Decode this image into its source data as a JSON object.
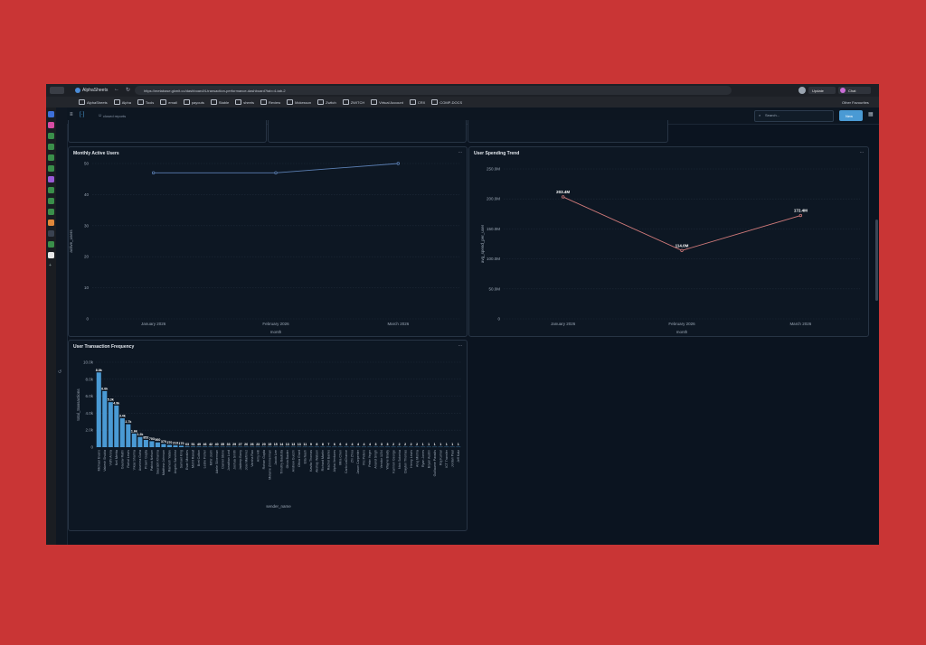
{
  "browser": {
    "tab_title": "AlphaSheets",
    "url": "https://metabase.gkmit.co/dashboard/4-transaction-performance-dashboard?tab=4-tab-2",
    "update_label": "Update",
    "chat_label": "Chat",
    "bookmarks": [
      "AlphaSheets",
      "Alpha",
      "Tools",
      "email",
      "payouts",
      "Stable",
      "sheets",
      "Review",
      "Mckesson",
      "Zwitch",
      "ZWITCH",
      "Virtual Account",
      "CRX",
      "COMP-DOCS"
    ],
    "other_favourites": "Other Favourites"
  },
  "app": {
    "breadcrumb": "closed reports",
    "search_placeholder": "Search...",
    "new_button": "New",
    "accent": "#4a9ad4"
  },
  "cards": {
    "mau": {
      "title": "Monthly Active Users",
      "menu": "...",
      "chart_data": {
        "type": "line",
        "title": "Monthly Active Users",
        "categories": [
          "January 2026",
          "February 2026",
          "March 2026"
        ],
        "values": [
          47,
          47,
          50
        ],
        "xlabel": "month",
        "ylabel": "active_users",
        "yticks": [
          "50",
          "40",
          "30",
          "20",
          "10",
          "0"
        ],
        "ylim": [
          0,
          50
        ],
        "color": "#5b7fb3",
        "grid": true
      }
    },
    "spend": {
      "title": "User Spending Trend",
      "menu": "...",
      "chart_data": {
        "type": "line",
        "title": "User Spending Trend",
        "categories": [
          "January 2026",
          "February 2026",
          "March 2026"
        ],
        "values": [
          203.4,
          114.0,
          172.4
        ],
        "point_labels": [
          "203.4M",
          "114.0M",
          "172.4M"
        ],
        "xlabel": "month",
        "ylabel": "avg_spend_per_user",
        "yticks": [
          "250.0M",
          "200.0M",
          "150.0M",
          "100.0M",
          "50.0M",
          "0"
        ],
        "ylim": [
          0,
          250
        ],
        "color": "#d17a7a",
        "grid": true
      }
    },
    "freq": {
      "title": "User Transaction Frequency",
      "menu": "...",
      "chart_data": {
        "type": "bar",
        "title": "User Transaction Frequency",
        "categories": [
          "Michael Evans",
          "Vakesh Shukla",
          "Vidhi Arora",
          "Neil Mehta",
          "Gaurav Rathi",
          "Rahul Lewis",
          "Vikas Sharma",
          "Arunima Guha",
          "Pravin Gupta",
          "Patrick Nelson",
          "Saurabh Khanna",
          "Matthew Johnson",
          "Ramesh Yadav",
          "Angelo Sanchez",
          "Samuel King",
          "Evan Morales",
          "Mohit Rawat",
          "Bret Colton",
          "Leslie Fisher",
          "Mihir Joshi",
          "Adele Silverman",
          "Daniel Stone",
          "Jonathan Lord",
          "Joshua Smith",
          "Jaideep Barry",
          "Jose Martinez",
          "Varsha Rao",
          "Amy Hill",
          "Rohan Gupta",
          "Melanie Zimmerman",
          "Jacob Lee",
          "Timothy Bautista",
          "Olivia Baxter",
          "Andrew Gucchi",
          "Olivia Grant",
          "Ella Nash",
          "Kavita Thomas",
          "Akshay Watson",
          "Richard Martin",
          "Rachel Banks",
          "Alpha Ventures",
          "Mira Chen",
          "Carlo LaChance",
          "Zhi Zhou",
          "Jason Carpenter",
          "Ric Peters",
          "Peter Yeger",
          "Anand Singh",
          "Vendor 1234",
          "Wayne Brady",
          "Kamron George",
          "Nick Solonka",
          "Clayton Thomas",
          "Henry Lewis",
          "Anuj Mishra",
          "Ryan Jones",
          "Bryan Austin",
          "Guillaume Paradis",
          "Raj Kumar",
          "ICT Transfer",
          "Jordan Paul",
          "Jeff Katz"
        ],
        "values": [
          8800,
          6600,
          5300,
          4900,
          3400,
          2700,
          1600,
          1200,
          850,
          700,
          560,
          370,
          270,
          210,
          170,
          63,
          51,
          49,
          46,
          42,
          40,
          35,
          33,
          29,
          27,
          26,
          26,
          23,
          20,
          15,
          15,
          14,
          13,
          13,
          13,
          11,
          9,
          8,
          8,
          7,
          6,
          6,
          4,
          4,
          4,
          4,
          4,
          3,
          3,
          3,
          2,
          2,
          2,
          2,
          2,
          1,
          1,
          1,
          1,
          1,
          1,
          1
        ],
        "value_labels": [
          "8.8k",
          "6.6k",
          "5.3k",
          "4.9k",
          "3.4k",
          "2.7k",
          "1.6k",
          "1.2k",
          "852",
          "703",
          "560",
          "370",
          "270",
          "213",
          "170",
          "63",
          "51",
          "49",
          "46",
          "42",
          "40",
          "35",
          "33",
          "29",
          "27",
          "26",
          "26",
          "23",
          "20",
          "15",
          "15",
          "14",
          "13",
          "13",
          "13",
          "11",
          "9",
          "8",
          "8",
          "7",
          "6",
          "6",
          "4",
          "4",
          "4",
          "4",
          "4",
          "3",
          "3",
          "3",
          "2",
          "2",
          "2",
          "2",
          "2",
          "1",
          "1",
          "1",
          "1",
          "1",
          "1",
          "1"
        ],
        "xlabel": "sender_name",
        "ylabel": "total_transactions",
        "yticks": [
          "10.0k",
          "8.0k",
          "6.0k",
          "4.0k",
          "2.0k",
          "0"
        ],
        "ylim": [
          0,
          10000
        ],
        "color": "#4a9ad4",
        "grid": true
      }
    }
  }
}
